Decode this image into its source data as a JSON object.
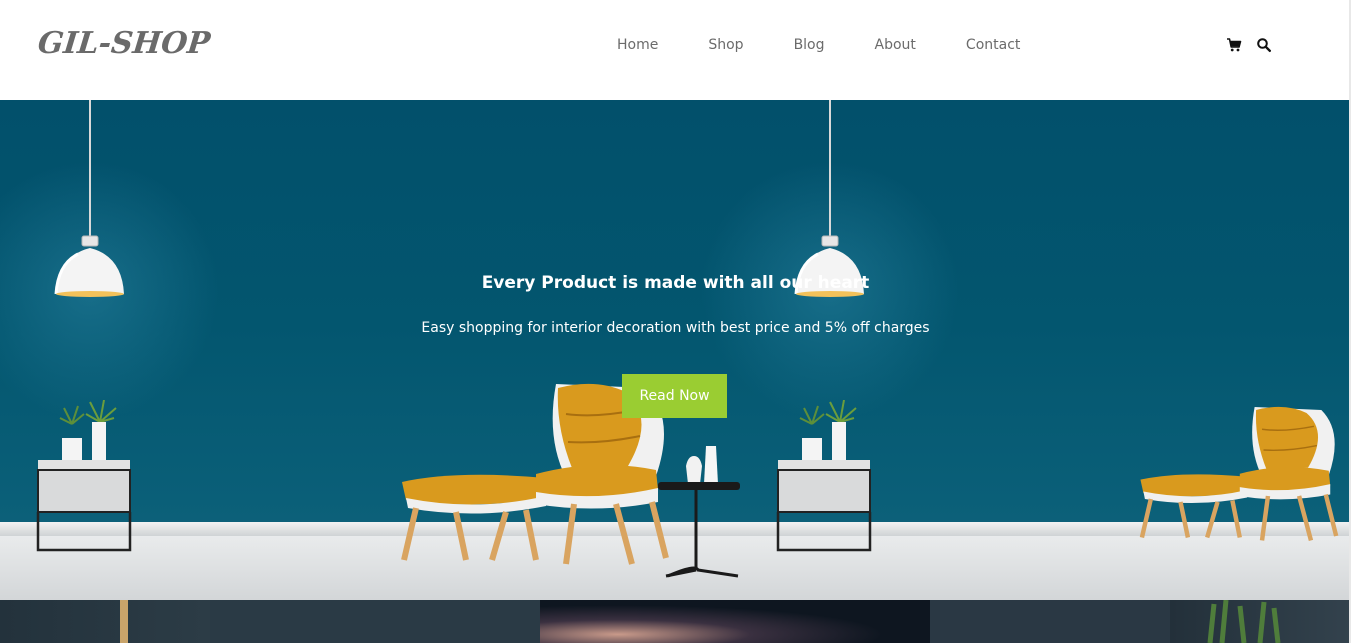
{
  "brand": {
    "logo_text": "GIL-SHOP"
  },
  "nav": {
    "items": [
      {
        "label": "Home"
      },
      {
        "label": "Shop"
      },
      {
        "label": "Blog"
      },
      {
        "label": "About"
      },
      {
        "label": "Contact"
      }
    ]
  },
  "header_icons": [
    {
      "icon": "cart-icon"
    },
    {
      "icon": "search-icon"
    }
  ],
  "hero": {
    "title": "Every Product is made with all our heart",
    "subtitle": "Easy shopping for interior decoration with best price and 5% off charges",
    "cta_label": "Read Now"
  },
  "colors": {
    "accent": "#9acd32",
    "hero_background": "#02506b",
    "chair_cushion": "#d99a1e",
    "nav_text": "#6b6b6b"
  }
}
